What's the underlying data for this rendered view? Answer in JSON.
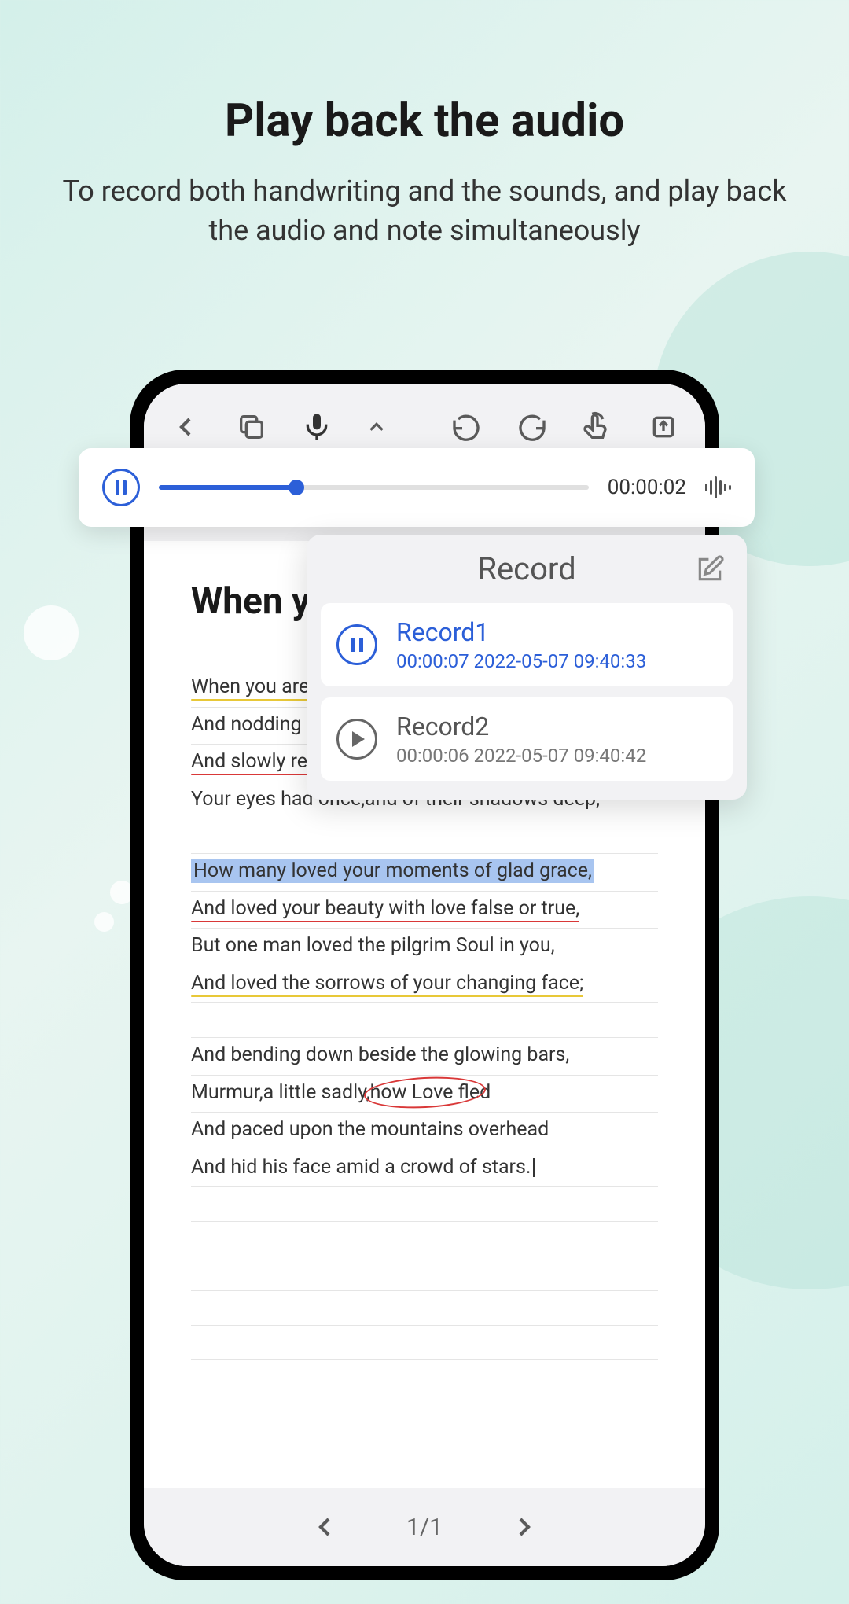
{
  "hero": {
    "title": "Play back the audio",
    "subtitle": "To record both handwriting and the sounds, and play back the audio and note simultaneously"
  },
  "player": {
    "time": "00:00:02"
  },
  "record_panel": {
    "title": "Record",
    "items": [
      {
        "name": "Record1",
        "duration": "00:00:07",
        "timestamp": "2022-05-07 09:40:33",
        "active": true
      },
      {
        "name": "Record2",
        "duration": "00:00:06",
        "timestamp": "2022-05-07 09:40:42",
        "active": false
      }
    ]
  },
  "note": {
    "title": "When y",
    "lines": [
      "When you are",
      "And nodding by the fire,  take down this book,",
      "And slowly read,and dream of the soft look",
      "Your eyes had once,and of their shadows deep;",
      "",
      "How many loved your moments of glad grace,",
      "And loved your beauty with love false or true,",
      "But one man loved the pilgrim Soul in you,",
      "And loved the sorrows of your changing face;",
      "",
      "And bending down beside the glowing bars,",
      "Murmur,a little sadly,how Love fled",
      "And paced upon the mountains overhead",
      "And hid his face amid a crowd of stars."
    ]
  },
  "pagination": {
    "label": "1/1"
  }
}
